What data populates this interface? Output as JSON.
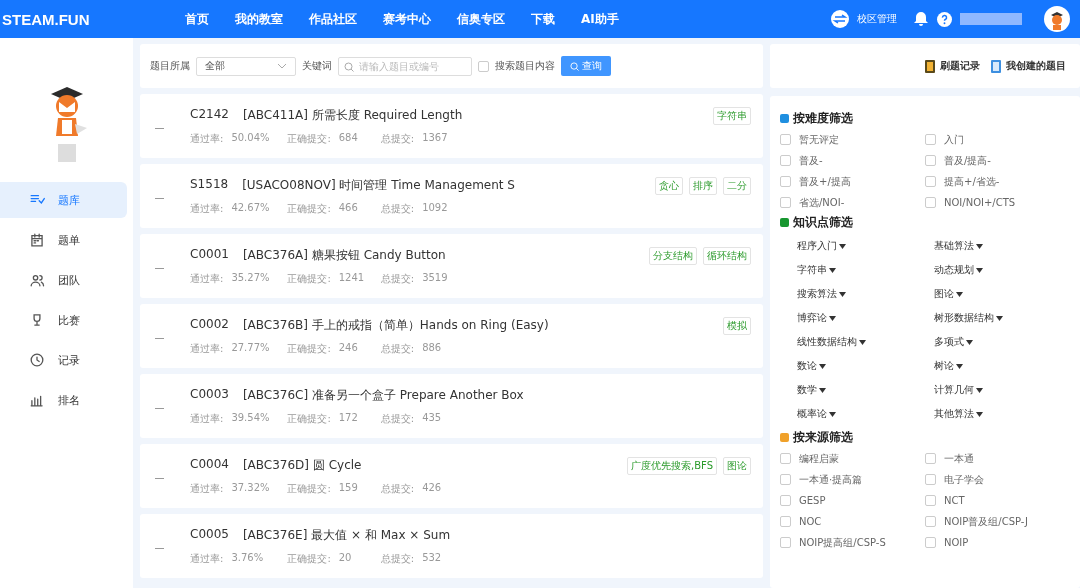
{
  "header": {
    "logo": "STEAM.FUN",
    "nav": [
      {
        "label": "首页",
        "selected": false
      },
      {
        "label": "我的教室",
        "selected": false
      },
      {
        "label": "作品社区",
        "selected": false
      },
      {
        "label": "赛考中心",
        "selected": false
      },
      {
        "label": "信奥专区",
        "selected": false
      },
      {
        "label": "下载",
        "selected": false
      },
      {
        "label": "AI助手",
        "selected": false
      }
    ],
    "campus": "校区管理"
  },
  "sidebar": {
    "items": [
      {
        "label": "题库",
        "selected": true
      },
      {
        "label": "题单",
        "selected": false
      },
      {
        "label": "团队",
        "selected": false
      },
      {
        "label": "比赛",
        "selected": false
      },
      {
        "label": "记录",
        "selected": false
      },
      {
        "label": "排名",
        "selected": false
      }
    ]
  },
  "filter_bar": {
    "category_label": "题目所属",
    "category_value": "全部",
    "keyword_label": "关键词",
    "keyword_placeholder": "请输入题目或编号",
    "content_search": {
      "label": "搜索题目内容",
      "checked": false
    },
    "query_button": "查询"
  },
  "problems": [
    {
      "id": "C2142",
      "title": "[ABC411A] 所需长度 Required Length",
      "pass_label": "通过率:",
      "pass_rate": "50.04%",
      "correct_label": "正确提交:",
      "correct": "684",
      "total_label": "总提交:",
      "total": "1367",
      "tags": [
        "字符串"
      ]
    },
    {
      "id": "S1518",
      "title": "[USACO08NOV] 时间管理 Time Management S",
      "pass_label": "通过率:",
      "pass_rate": "42.67%",
      "correct_label": "正确提交:",
      "correct": "466",
      "total_label": "总提交:",
      "total": "1092",
      "tags": [
        "贪心",
        "排序",
        "二分"
      ]
    },
    {
      "id": "C0001",
      "title": "[ABC376A] 糖果按钮 Candy Button",
      "pass_label": "通过率:",
      "pass_rate": "35.27%",
      "correct_label": "正确提交:",
      "correct": "1241",
      "total_label": "总提交:",
      "total": "3519",
      "tags": [
        "分支结构",
        "循环结构"
      ]
    },
    {
      "id": "C0002",
      "title": "[ABC376B] 手上的戒指（简单）Hands on Ring (Easy)",
      "pass_label": "通过率:",
      "pass_rate": "27.77%",
      "correct_label": "正确提交:",
      "correct": "246",
      "total_label": "总提交:",
      "total": "886",
      "tags": [
        "模拟"
      ]
    },
    {
      "id": "C0003",
      "title": "[ABC376C] 准备另一个盒子 Prepare Another Box",
      "pass_label": "通过率:",
      "pass_rate": "39.54%",
      "correct_label": "正确提交:",
      "correct": "172",
      "total_label": "总提交:",
      "total": "435"
    },
    {
      "id": "C0004",
      "title": "[ABC376D] 圆 Cycle",
      "pass_label": "通过率:",
      "pass_rate": "37.32%",
      "correct_label": "正确提交:",
      "correct": "159",
      "total_label": "总提交:",
      "total": "426",
      "tags": [
        "广度优先搜索,BFS",
        "图论"
      ]
    },
    {
      "id": "C0005",
      "title": "[ABC376E] 最大值 × 和 Max × Sum",
      "pass_label": "通过率:",
      "pass_rate": "3.76%",
      "correct_label": "正确提交:",
      "correct": "20",
      "total_label": "总提交:",
      "total": "532"
    }
  ],
  "quick_links": [
    "刷题记录",
    "我创建的题目"
  ],
  "difficulty": {
    "title": "按难度筛选",
    "options": [
      {
        "label": "暂无评定",
        "checked": false
      },
      {
        "label": "入门",
        "checked": false
      },
      {
        "label": "普及-",
        "checked": false
      },
      {
        "label": "普及/提高-",
        "checked": false
      },
      {
        "label": "普及+/提高",
        "checked": false
      },
      {
        "label": "提高+/省选-",
        "checked": false
      },
      {
        "label": "省选/NOI-",
        "checked": false
      },
      {
        "label": "NOI/NOI+/CTS",
        "checked": false
      }
    ]
  },
  "knowledge": {
    "title": "知识点筛选",
    "options": [
      "程序入门",
      "基础算法",
      "字符串",
      "动态规划",
      "搜索算法",
      "图论",
      "博弈论",
      "树形数据结构",
      "线性数据结构",
      "多项式",
      "数论",
      "树论",
      "数学",
      "计算几何",
      "概率论",
      "其他算法"
    ]
  },
  "source": {
    "title": "按来源筛选",
    "options": [
      {
        "label": "编程启蒙",
        "checked": false
      },
      {
        "label": "一本通",
        "checked": false
      },
      {
        "label": "一本通·提高篇",
        "checked": false
      },
      {
        "label": "电子学会",
        "checked": false
      },
      {
        "label": "GESP",
        "checked": false
      },
      {
        "label": "NCT",
        "checked": false
      },
      {
        "label": "NOC",
        "checked": false
      },
      {
        "label": "NOIP普及组/CSP-J",
        "checked": false
      },
      {
        "label": "NOIP提高组/CSP-S",
        "checked": false
      },
      {
        "label": "NOIP",
        "checked": false
      }
    ]
  }
}
